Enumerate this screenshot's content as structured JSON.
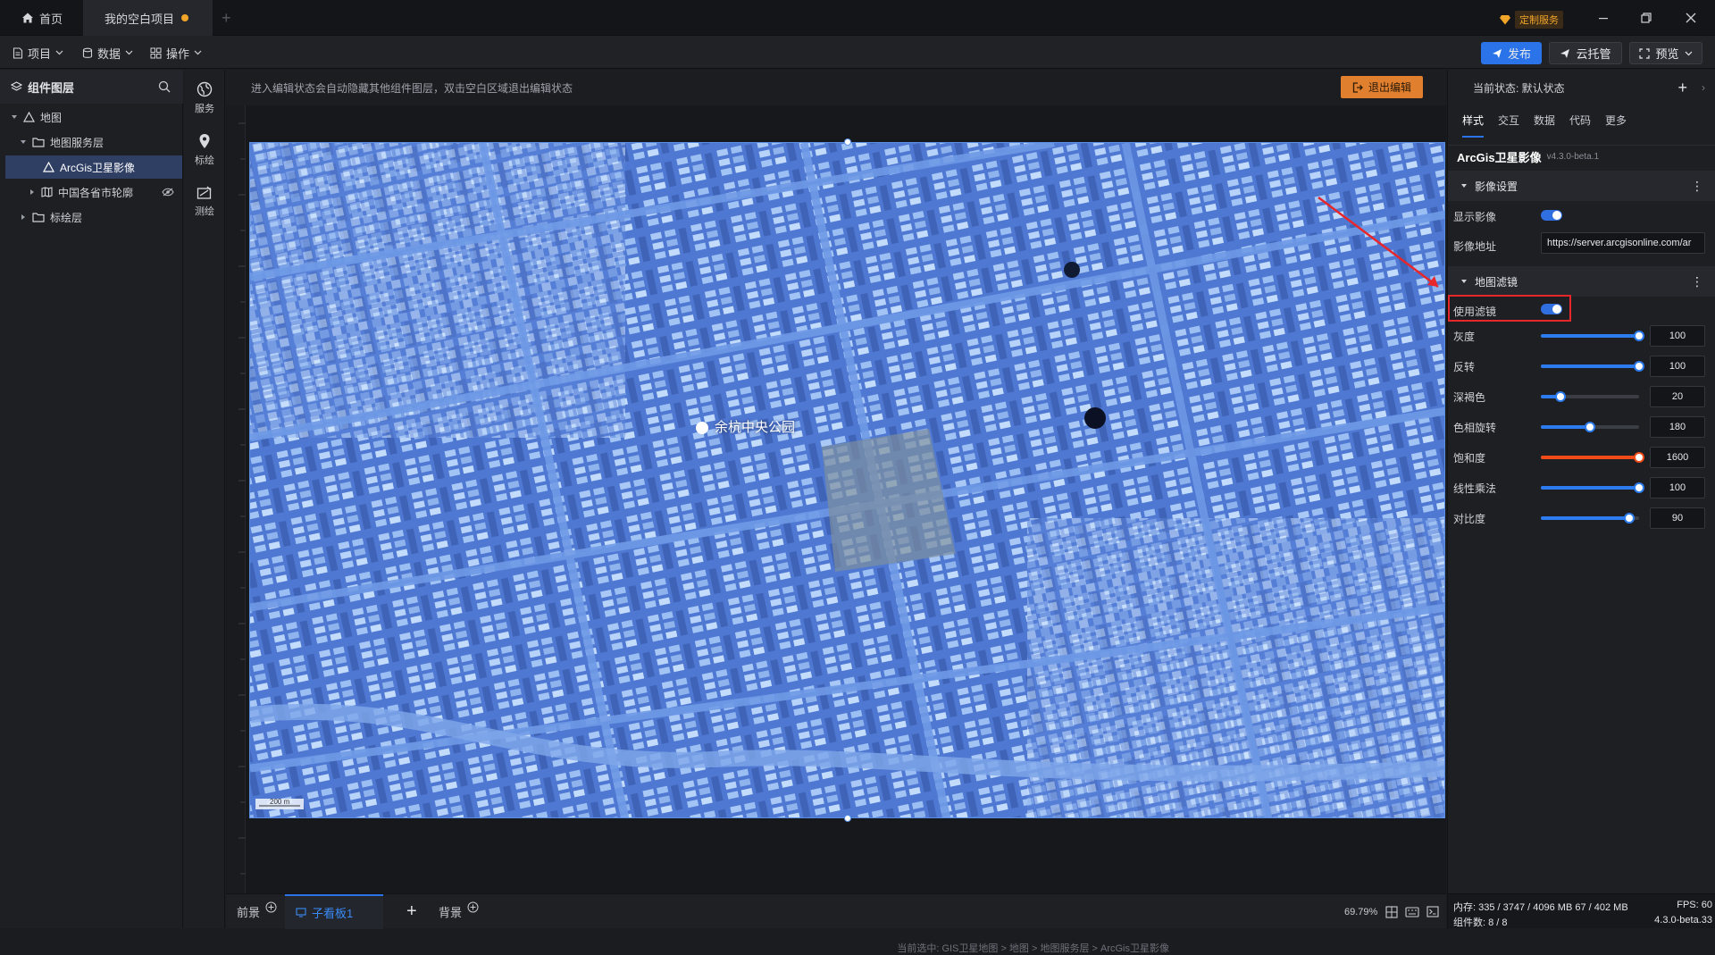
{
  "titlebar": {
    "home_tab": "首页",
    "project_tab": "我的空白项目",
    "custom_service": "定制服务",
    "colors": {
      "accent": "#f0a528"
    }
  },
  "toolbar": {
    "menus": [
      "项目",
      "数据",
      "操作"
    ],
    "publish": "发布",
    "cloud_host": "云托管",
    "preview": "预览"
  },
  "left_panel": {
    "title": "组件图层",
    "tree": [
      "地图",
      "地图服务层",
      "ArcGis卫星影像",
      "中国各省市轮廓",
      "标绘层"
    ]
  },
  "side_tools": [
    "服务",
    "标绘",
    "测绘"
  ],
  "canvas": {
    "hint": "进入编辑状态会自动隐藏其他组件图层，双击空白区域退出编辑状态",
    "exit_edit": "退出编辑",
    "map_label": "余杭中央公园",
    "scale": "200 m",
    "breadcrumb": "当前选中: GIS卫星地图 > 地图 > 地图服务层 > ArcGis卫星影像"
  },
  "bottom": {
    "foreground": "前景",
    "child_panel": "子看板1",
    "background": "背景",
    "zoom": "69.79%"
  },
  "right_panel": {
    "state_label": "当前状态: 默认状态",
    "tabs": [
      "样式",
      "交互",
      "数据",
      "代码",
      "更多"
    ],
    "component_name": "ArcGis卫星影像",
    "component_version": "v4.3.0-beta.1",
    "section_image": "影像设置",
    "show_image_label": "显示影像",
    "show_image": true,
    "image_url_label": "影像地址",
    "image_url": "https://server.arcgisonline.com/ar",
    "section_filter": "地图滤镜",
    "use_filter_label": "使用滤镜",
    "use_filter": true,
    "filters": [
      {
        "label": "灰度",
        "value": "100",
        "fraction": 1.0,
        "color": "#2c7cf0"
      },
      {
        "label": "反转",
        "value": "100",
        "fraction": 1.0,
        "color": "#2c7cf0"
      },
      {
        "label": "深褐色",
        "value": "20",
        "fraction": 0.2,
        "color": "#2c7cf0"
      },
      {
        "label": "色相旋转",
        "value": "180",
        "fraction": 0.5,
        "color": "#2c7cf0"
      },
      {
        "label": "饱和度",
        "value": "1600",
        "fraction": 1.0,
        "color": "#f04a18"
      },
      {
        "label": "线性乘法",
        "value": "100",
        "fraction": 1.0,
        "color": "#2c7cf0"
      },
      {
        "label": "对比度",
        "value": "90",
        "fraction": 0.9,
        "color": "#2c7cf0"
      }
    ]
  },
  "status": {
    "memory": "内存: 335 / 3747 / 4096 MB  67 / 402 MB",
    "fps": "FPS: 60",
    "components": "组件数: 8 / 8",
    "version": "4.3.0-beta.33"
  }
}
